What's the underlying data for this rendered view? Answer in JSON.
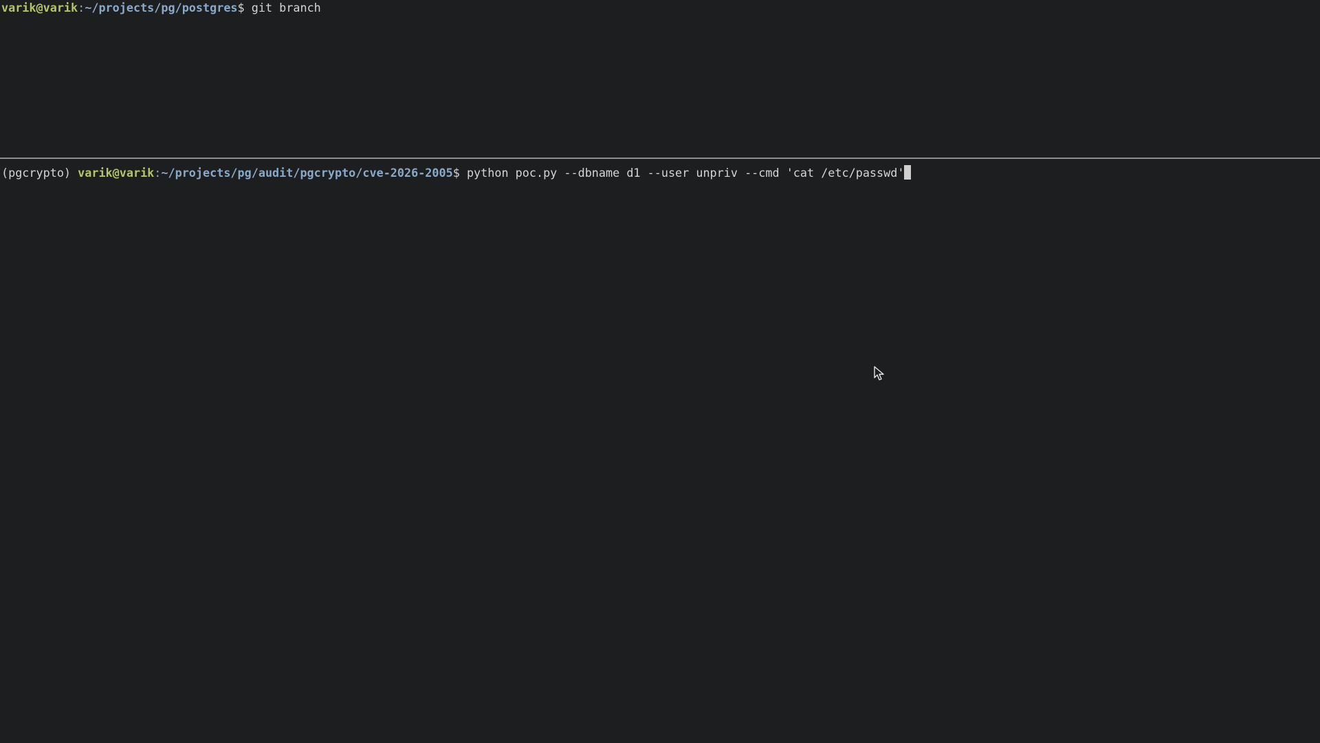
{
  "colors": {
    "background": "#1c1e20",
    "user": "#b6c36b",
    "path": "#8aa8c7",
    "text": "#d4d4d4",
    "divider": "#8f8f8f"
  },
  "top_pane": {
    "user_host": "varik@varik",
    "colon": ":",
    "path": "~/projects/pg/postgres",
    "prompt_symbol": "$",
    "command": " git branch"
  },
  "bottom_pane": {
    "venv": "(pgcrypto) ",
    "user_host": "varik@varik",
    "colon": ":",
    "path": "~/projects/pg/audit/pgcrypto/cve-2026-2005",
    "prompt_symbol": "$",
    "command": " python poc.py --dbname d1 --user unpriv --cmd 'cat /etc/passwd'"
  },
  "icons": {
    "mouse_pointer": "arrow-pointer-icon",
    "cursor": "block-cursor"
  }
}
